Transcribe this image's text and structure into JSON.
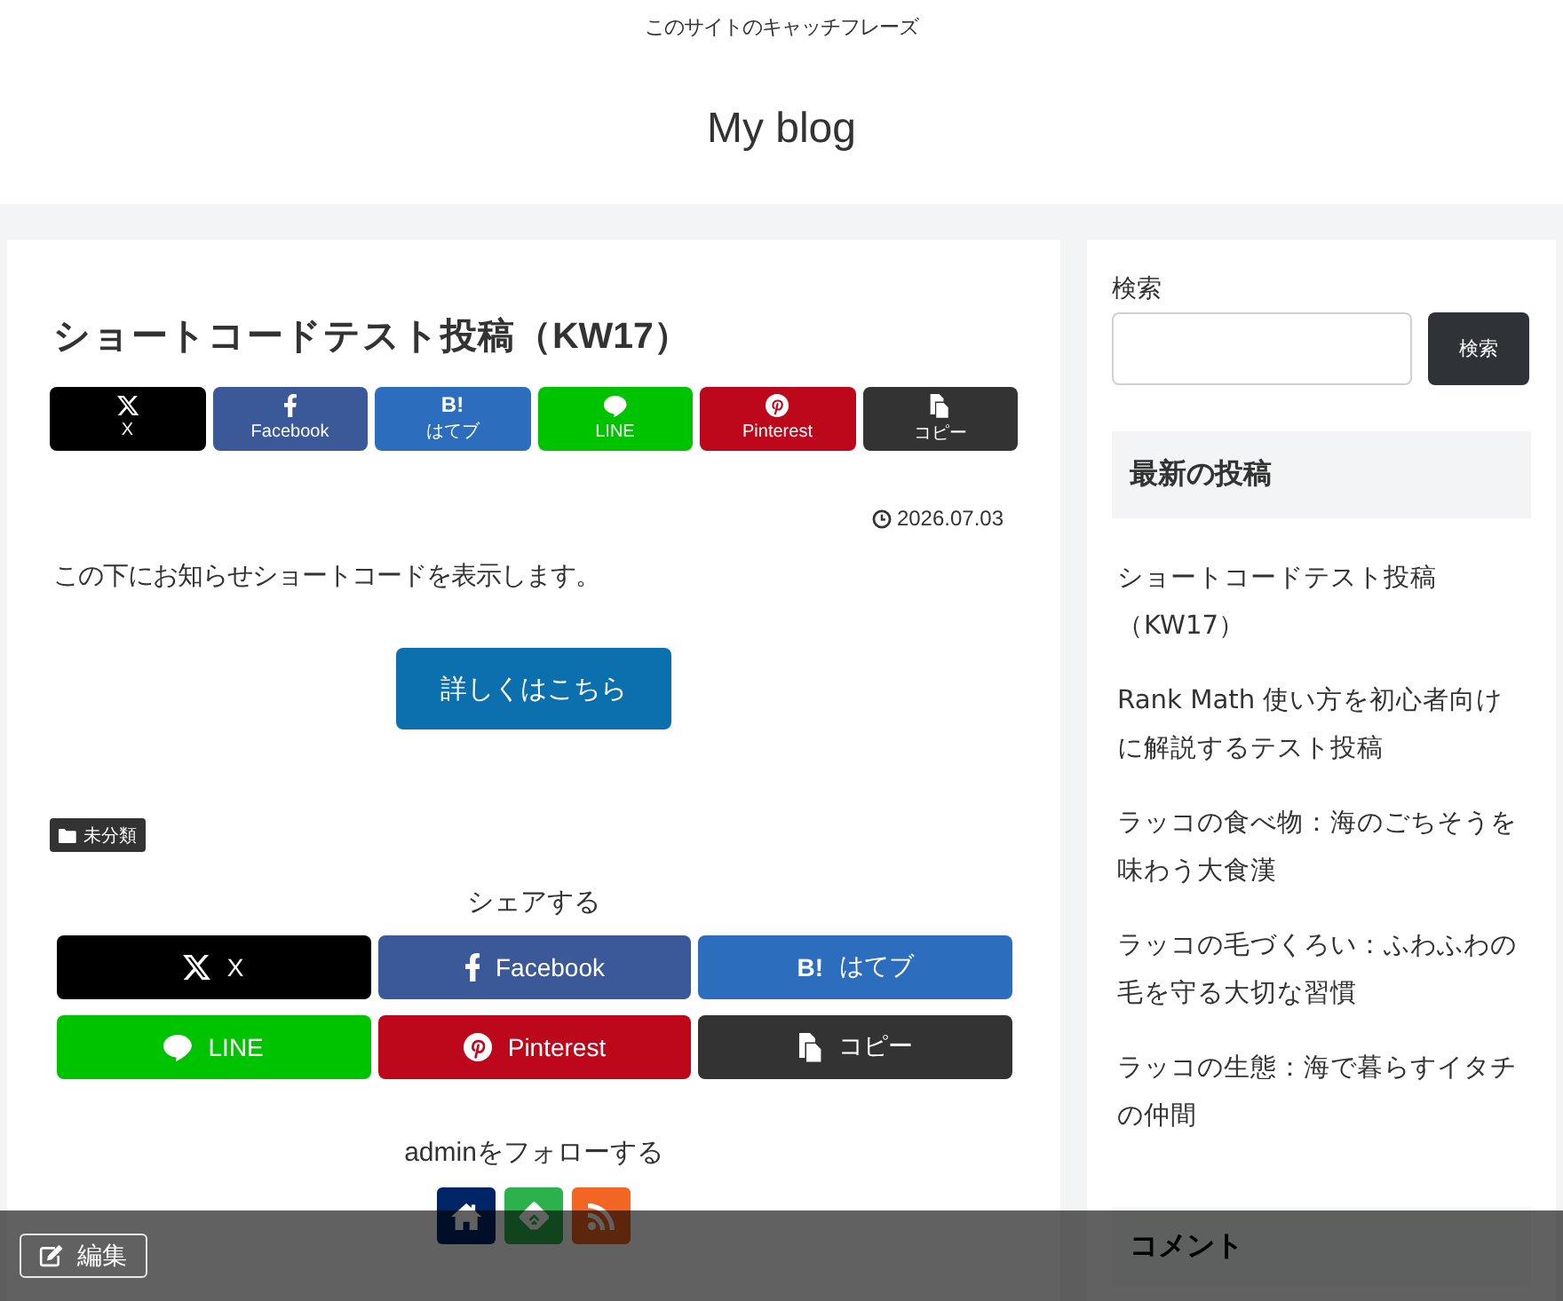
{
  "header": {
    "tagline": "このサイトのキャッチフレーズ",
    "site_title": "My blog"
  },
  "post": {
    "title": "ショートコードテスト投稿（KW17）",
    "top_share": [
      {
        "kind": "x",
        "label": "X"
      },
      {
        "kind": "facebook",
        "label": "Facebook"
      },
      {
        "kind": "hatena",
        "icon_text": "B!",
        "label": "はてブ"
      },
      {
        "kind": "line",
        "label": "LINE"
      },
      {
        "kind": "pinterest",
        "label": "Pinterest"
      },
      {
        "kind": "copy",
        "label": "コピー"
      }
    ],
    "date": "2026.07.03",
    "body": "この下にお知らせショートコードを表示します。",
    "cta_button": "詳しくはこちら",
    "category": "未分類",
    "share_heading": "シェアする",
    "bottom_share": [
      {
        "kind": "x",
        "label": "X"
      },
      {
        "kind": "facebook",
        "label": "Facebook"
      },
      {
        "kind": "hatena",
        "icon_text": "B!",
        "label": "はてブ"
      },
      {
        "kind": "line",
        "label": "LINE"
      },
      {
        "kind": "pinterest",
        "label": "Pinterest"
      },
      {
        "kind": "copy",
        "label": "コピー"
      }
    ],
    "follow_heading": "adminをフォローする",
    "follow_buttons": [
      {
        "kind": "home"
      },
      {
        "kind": "feedly"
      },
      {
        "kind": "rss"
      }
    ]
  },
  "sidebar": {
    "search": {
      "label": "検索",
      "button": "検索"
    },
    "recent_heading": "最新の投稿",
    "recent_posts": [
      "ショートコードテスト投稿（KW17）",
      "Rank Math 使い方を初心者向けに解説するテスト投稿",
      "ラッコの食べ物：海のごちそうを味わう大食漢",
      "ラッコの毛づくろい：ふわふわの毛を守る大切な習慣",
      "ラッコの生態：海で暮らすイタチの仲間"
    ],
    "comments_heading": "コメント"
  },
  "admin_bar": {
    "edit_button": "編集"
  }
}
